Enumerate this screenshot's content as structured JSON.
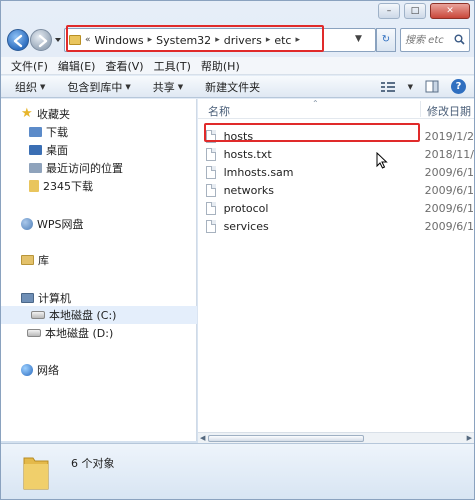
{
  "address": {
    "overflow": "«",
    "crumbs": [
      "Windows",
      "System32",
      "drivers",
      "etc"
    ]
  },
  "search": {
    "placeholder": "搜索 etc"
  },
  "menu": [
    "文件(F)",
    "编辑(E)",
    "查看(V)",
    "工具(T)",
    "帮助(H)"
  ],
  "toolbar": {
    "organize": "组织",
    "include_library": "包含到库中",
    "share": "共享",
    "new_folder": "新建文件夹"
  },
  "nav": {
    "favorites": "收藏夹",
    "downloads": "下载",
    "desktop": "桌面",
    "recent": "最近访问的位置",
    "downloads_2345": "2345下载",
    "wps": "WPS网盘",
    "libraries": "库",
    "computer": "计算机",
    "disk_c": "本地磁盘 (C:)",
    "disk_d": "本地磁盘 (D:)",
    "network": "网络"
  },
  "columns": {
    "name": "名称",
    "date": "修改日期"
  },
  "files": [
    {
      "name": "hosts",
      "date": "2019/1/2"
    },
    {
      "name": "hosts.txt",
      "date": "2018/11/"
    },
    {
      "name": "lmhosts.sam",
      "date": "2009/6/1"
    },
    {
      "name": "networks",
      "date": "2009/6/1"
    },
    {
      "name": "protocol",
      "date": "2009/6/1"
    },
    {
      "name": "services",
      "date": "2009/6/1"
    }
  ],
  "status": {
    "item_count": "6 个对象"
  },
  "colors": {
    "highlight": "#e02a2a",
    "accent": "#2f6fc0",
    "folder": "#e9c55d"
  }
}
